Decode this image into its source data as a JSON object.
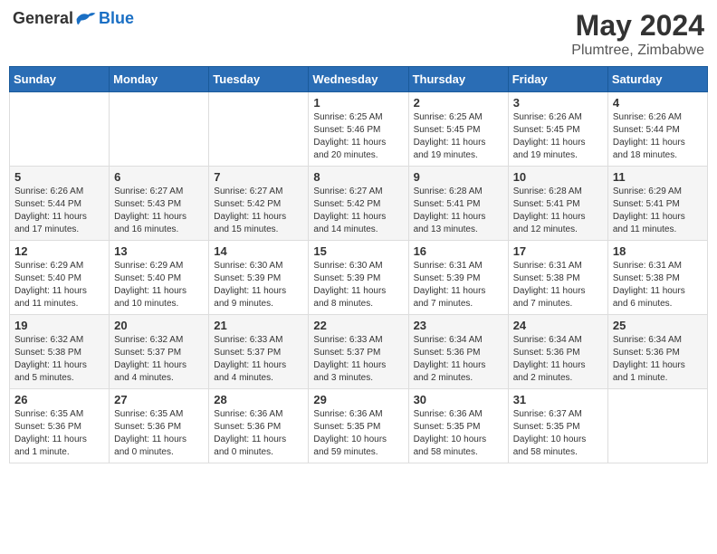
{
  "header": {
    "logo_general": "General",
    "logo_blue": "Blue",
    "month_title": "May 2024",
    "location": "Plumtree, Zimbabwe"
  },
  "calendar": {
    "days_of_week": [
      "Sunday",
      "Monday",
      "Tuesday",
      "Wednesday",
      "Thursday",
      "Friday",
      "Saturday"
    ],
    "weeks": [
      [
        {
          "day": "",
          "info": ""
        },
        {
          "day": "",
          "info": ""
        },
        {
          "day": "",
          "info": ""
        },
        {
          "day": "1",
          "info": "Sunrise: 6:25 AM\nSunset: 5:46 PM\nDaylight: 11 hours\nand 20 minutes."
        },
        {
          "day": "2",
          "info": "Sunrise: 6:25 AM\nSunset: 5:45 PM\nDaylight: 11 hours\nand 19 minutes."
        },
        {
          "day": "3",
          "info": "Sunrise: 6:26 AM\nSunset: 5:45 PM\nDaylight: 11 hours\nand 19 minutes."
        },
        {
          "day": "4",
          "info": "Sunrise: 6:26 AM\nSunset: 5:44 PM\nDaylight: 11 hours\nand 18 minutes."
        }
      ],
      [
        {
          "day": "5",
          "info": "Sunrise: 6:26 AM\nSunset: 5:44 PM\nDaylight: 11 hours\nand 17 minutes."
        },
        {
          "day": "6",
          "info": "Sunrise: 6:27 AM\nSunset: 5:43 PM\nDaylight: 11 hours\nand 16 minutes."
        },
        {
          "day": "7",
          "info": "Sunrise: 6:27 AM\nSunset: 5:42 PM\nDaylight: 11 hours\nand 15 minutes."
        },
        {
          "day": "8",
          "info": "Sunrise: 6:27 AM\nSunset: 5:42 PM\nDaylight: 11 hours\nand 14 minutes."
        },
        {
          "day": "9",
          "info": "Sunrise: 6:28 AM\nSunset: 5:41 PM\nDaylight: 11 hours\nand 13 minutes."
        },
        {
          "day": "10",
          "info": "Sunrise: 6:28 AM\nSunset: 5:41 PM\nDaylight: 11 hours\nand 12 minutes."
        },
        {
          "day": "11",
          "info": "Sunrise: 6:29 AM\nSunset: 5:41 PM\nDaylight: 11 hours\nand 11 minutes."
        }
      ],
      [
        {
          "day": "12",
          "info": "Sunrise: 6:29 AM\nSunset: 5:40 PM\nDaylight: 11 hours\nand 11 minutes."
        },
        {
          "day": "13",
          "info": "Sunrise: 6:29 AM\nSunset: 5:40 PM\nDaylight: 11 hours\nand 10 minutes."
        },
        {
          "day": "14",
          "info": "Sunrise: 6:30 AM\nSunset: 5:39 PM\nDaylight: 11 hours\nand 9 minutes."
        },
        {
          "day": "15",
          "info": "Sunrise: 6:30 AM\nSunset: 5:39 PM\nDaylight: 11 hours\nand 8 minutes."
        },
        {
          "day": "16",
          "info": "Sunrise: 6:31 AM\nSunset: 5:39 PM\nDaylight: 11 hours\nand 7 minutes."
        },
        {
          "day": "17",
          "info": "Sunrise: 6:31 AM\nSunset: 5:38 PM\nDaylight: 11 hours\nand 7 minutes."
        },
        {
          "day": "18",
          "info": "Sunrise: 6:31 AM\nSunset: 5:38 PM\nDaylight: 11 hours\nand 6 minutes."
        }
      ],
      [
        {
          "day": "19",
          "info": "Sunrise: 6:32 AM\nSunset: 5:38 PM\nDaylight: 11 hours\nand 5 minutes."
        },
        {
          "day": "20",
          "info": "Sunrise: 6:32 AM\nSunset: 5:37 PM\nDaylight: 11 hours\nand 4 minutes."
        },
        {
          "day": "21",
          "info": "Sunrise: 6:33 AM\nSunset: 5:37 PM\nDaylight: 11 hours\nand 4 minutes."
        },
        {
          "day": "22",
          "info": "Sunrise: 6:33 AM\nSunset: 5:37 PM\nDaylight: 11 hours\nand 3 minutes."
        },
        {
          "day": "23",
          "info": "Sunrise: 6:34 AM\nSunset: 5:36 PM\nDaylight: 11 hours\nand 2 minutes."
        },
        {
          "day": "24",
          "info": "Sunrise: 6:34 AM\nSunset: 5:36 PM\nDaylight: 11 hours\nand 2 minutes."
        },
        {
          "day": "25",
          "info": "Sunrise: 6:34 AM\nSunset: 5:36 PM\nDaylight: 11 hours\nand 1 minute."
        }
      ],
      [
        {
          "day": "26",
          "info": "Sunrise: 6:35 AM\nSunset: 5:36 PM\nDaylight: 11 hours\nand 1 minute."
        },
        {
          "day": "27",
          "info": "Sunrise: 6:35 AM\nSunset: 5:36 PM\nDaylight: 11 hours\nand 0 minutes."
        },
        {
          "day": "28",
          "info": "Sunrise: 6:36 AM\nSunset: 5:36 PM\nDaylight: 11 hours\nand 0 minutes."
        },
        {
          "day": "29",
          "info": "Sunrise: 6:36 AM\nSunset: 5:35 PM\nDaylight: 10 hours\nand 59 minutes."
        },
        {
          "day": "30",
          "info": "Sunrise: 6:36 AM\nSunset: 5:35 PM\nDaylight: 10 hours\nand 58 minutes."
        },
        {
          "day": "31",
          "info": "Sunrise: 6:37 AM\nSunset: 5:35 PM\nDaylight: 10 hours\nand 58 minutes."
        },
        {
          "day": "",
          "info": ""
        }
      ]
    ]
  }
}
